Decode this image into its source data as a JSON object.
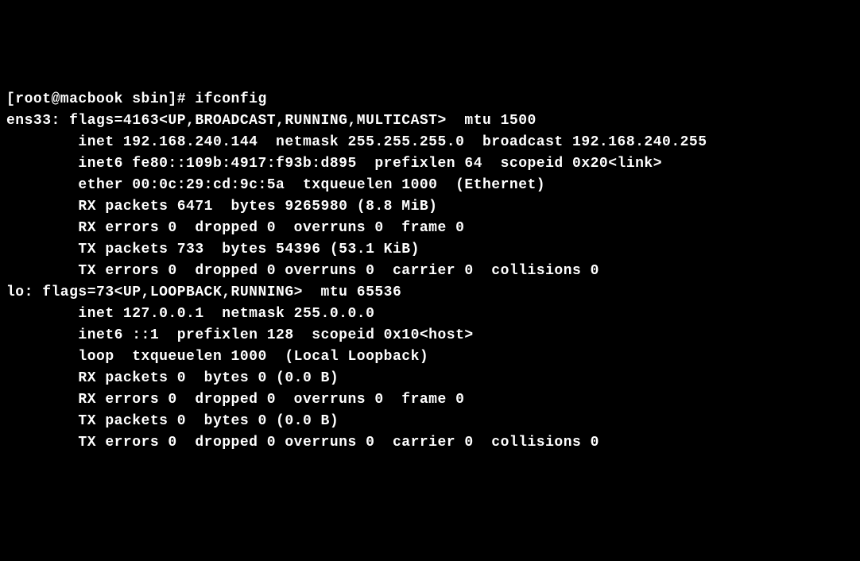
{
  "prompt": "[root@macbook sbin]# ",
  "command": "ifconfig",
  "interfaces": {
    "ens33": {
      "header": "ens33: flags=4163<UP,BROADCAST,RUNNING,MULTICAST>  mtu 1500",
      "inet": "        inet 192.168.240.144  netmask 255.255.255.0  broadcast 192.168.240.255",
      "inet6": "        inet6 fe80::109b:4917:f93b:d895  prefixlen 64  scopeid 0x20<link>",
      "ether": "        ether 00:0c:29:cd:9c:5a  txqueuelen 1000  (Ethernet)",
      "rxp": "        RX packets 6471  bytes 9265980 (8.8 MiB)",
      "rxe": "        RX errors 0  dropped 0  overruns 0  frame 0",
      "txp": "        TX packets 733  bytes 54396 (53.1 KiB)",
      "txe": "        TX errors 0  dropped 0 overruns 0  carrier 0  collisions 0"
    },
    "lo": {
      "header": "lo: flags=73<UP,LOOPBACK,RUNNING>  mtu 65536",
      "inet": "        inet 127.0.0.1  netmask 255.0.0.0",
      "inet6": "        inet6 ::1  prefixlen 128  scopeid 0x10<host>",
      "loop": "        loop  txqueuelen 1000  (Local Loopback)",
      "rxp": "        RX packets 0  bytes 0 (0.0 B)",
      "rxe": "        RX errors 0  dropped 0  overruns 0  frame 0",
      "txp": "        TX packets 0  bytes 0 (0.0 B)",
      "txe": "        TX errors 0  dropped 0 overruns 0  carrier 0  collisions 0"
    }
  },
  "blank": ""
}
